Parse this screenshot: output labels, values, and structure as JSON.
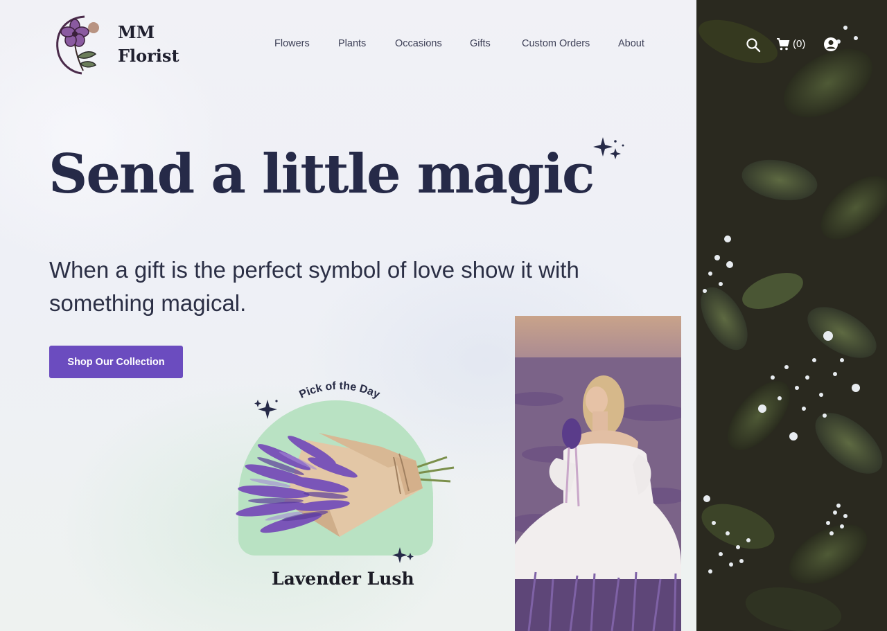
{
  "brand": {
    "name_line1": "MM",
    "name_line2": "Florist"
  },
  "nav": {
    "items": [
      {
        "label": "Flowers"
      },
      {
        "label": "Plants"
      },
      {
        "label": "Occasions"
      },
      {
        "label": "Gifts"
      },
      {
        "label": "Custom Orders"
      },
      {
        "label": "About"
      }
    ]
  },
  "header_icons": {
    "search": "search-icon",
    "cart": "cart-icon",
    "cart_count": "(0)",
    "account": "account-icon"
  },
  "hero": {
    "title": "Send a little magic",
    "subtitle": "When a gift is the perfect symbol of love show it with something magical.",
    "cta_label": "Shop Our Collection"
  },
  "pick": {
    "badge": "Pick of the Day",
    "product_name": "Lavender Lush"
  },
  "colors": {
    "accent": "#6b4cbf",
    "heading": "#262a48",
    "arch": "#b9e2c3",
    "lavender": "#7a55b8"
  }
}
